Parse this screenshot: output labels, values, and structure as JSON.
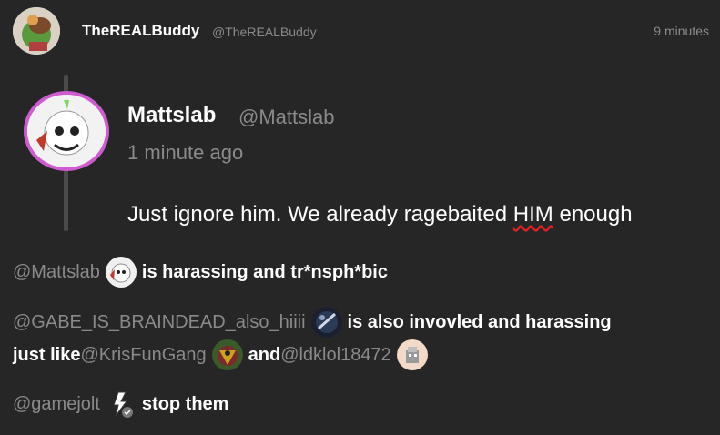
{
  "post": {
    "author_name": "TheREALBuddy",
    "author_handle": "@TheREALBuddy",
    "timestamp": "9 minutes"
  },
  "quote": {
    "author_name": "Mattslab",
    "author_handle": "@Mattslab",
    "time": "1 minute ago",
    "text_before": "Just ignore him. We already ragebaited ",
    "text_highlight": "HIM",
    "text_after": " enough"
  },
  "body": {
    "line1": {
      "mention": "@Mattslab",
      "text": " is harassing and tr*nsph*bic"
    },
    "line2": {
      "mention": "@GABE_IS_BRAINDEAD_also_hiiii",
      "text": " is also invovled and harassing"
    },
    "line3": {
      "prefix": "just like ",
      "mention1": "@KrisFunGang",
      "joiner": " and ",
      "mention2": "@ldklol18472"
    },
    "line4": {
      "mention": "@gamejolt",
      "text": " stop them"
    }
  },
  "colors": {
    "background": "#262626",
    "muted": "#8a8a8a",
    "avatar_ring": "#cf5bd0",
    "spell_underline": "#e32222"
  },
  "icons": [
    "user-avatar-icon",
    "mattslab-avatar-icon",
    "gabe-avatar-icon",
    "krisfungang-avatar-icon",
    "ldklol-avatar-icon",
    "gamejolt-logo-icon"
  ]
}
